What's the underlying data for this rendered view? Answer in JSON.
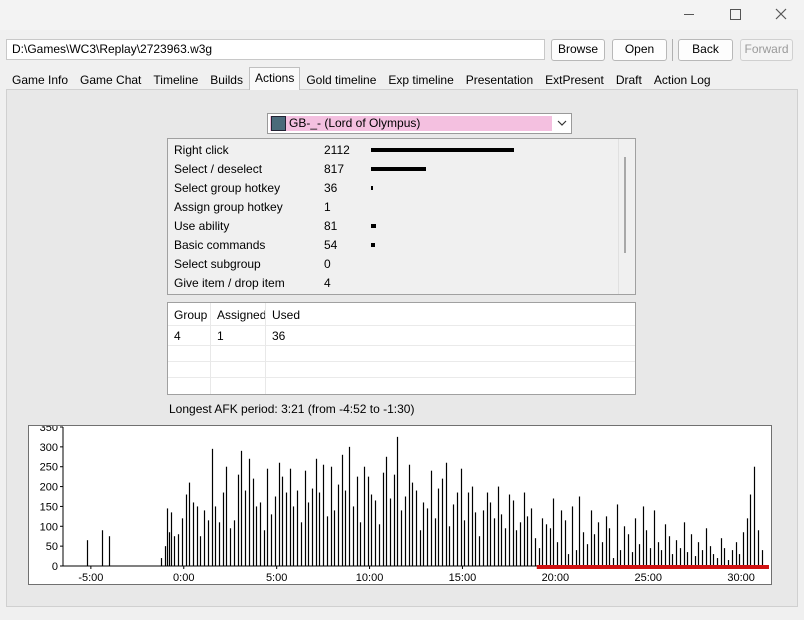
{
  "window": {
    "minimize_icon": "minimize-icon",
    "maximize_icon": "maximize-icon",
    "close_icon": "close-icon"
  },
  "toolbar": {
    "path": "D:\\Games\\WC3\\Replay\\2723963.w3g",
    "browse": "Browse",
    "open": "Open",
    "back": "Back",
    "forward": "Forward"
  },
  "tabs": [
    "Game Info",
    "Game Chat",
    "Timeline",
    "Builds",
    "Actions",
    "Gold timeline",
    "Exp timeline",
    "Presentation",
    "ExtPresent",
    "Draft",
    "Action Log"
  ],
  "active_tab": "Actions",
  "player": {
    "name": "GB-_- (Lord of Olympus)",
    "highlight_color": "#f4c0e0"
  },
  "actions": [
    {
      "name": "Right click",
      "count": 2112
    },
    {
      "name": "Select / deselect",
      "count": 817
    },
    {
      "name": "Select group hotkey",
      "count": 36
    },
    {
      "name": "Assign group hotkey",
      "count": 1
    },
    {
      "name": "Use ability",
      "count": 81
    },
    {
      "name": "Basic commands",
      "count": 54
    },
    {
      "name": "Select subgroup",
      "count": 0
    },
    {
      "name": "Give item / drop item",
      "count": 4
    }
  ],
  "hotkeys": {
    "headers": [
      "Group",
      "Assigned",
      "Used"
    ],
    "rows": [
      [
        "4",
        "1",
        "36"
      ]
    ]
  },
  "afk_text": "Longest AFK period: 3:21 (from -4:52 to -1:30)",
  "chart_data": {
    "type": "bar",
    "y_ticks": [
      0,
      50,
      100,
      150,
      200,
      250,
      300,
      350
    ],
    "ylim": [
      0,
      350
    ],
    "x_ticks": [
      "-5:00",
      "0:00",
      "5:00",
      "10:00",
      "15:00",
      "20:00",
      "25:00",
      "30:00"
    ],
    "x_tick_minutes": [
      -5,
      0,
      5,
      10,
      15,
      20,
      25,
      30
    ],
    "xlim_minutes": [
      -6.5,
      31.5
    ],
    "bar_color": "#000000",
    "afk_marker": {
      "from_minute": 19,
      "to_minute": 31.5,
      "color": "#d01010"
    },
    "x_minutes": [
      -5.2,
      -4.4,
      -4.0,
      -1.2,
      -1.0,
      -0.9,
      -0.8,
      -0.7,
      -0.5,
      -0.3,
      -0.1,
      0.1,
      0.3,
      0.5,
      0.7,
      0.9,
      1.1,
      1.3,
      1.5,
      1.7,
      1.9,
      2.1,
      2.3,
      2.5,
      2.7,
      2.9,
      3.1,
      3.3,
      3.5,
      3.7,
      3.9,
      4.1,
      4.3,
      4.5,
      4.7,
      4.9,
      5.1,
      5.3,
      5.5,
      5.7,
      5.9,
      6.1,
      6.3,
      6.5,
      6.7,
      6.9,
      7.1,
      7.3,
      7.5,
      7.7,
      7.9,
      8.1,
      8.3,
      8.5,
      8.7,
      8.9,
      9.1,
      9.3,
      9.5,
      9.7,
      9.9,
      10.1,
      10.3,
      10.5,
      10.7,
      10.9,
      11.1,
      11.3,
      11.5,
      11.7,
      11.9,
      12.1,
      12.3,
      12.5,
      12.7,
      12.9,
      13.1,
      13.3,
      13.5,
      13.7,
      13.9,
      14.1,
      14.3,
      14.5,
      14.7,
      14.9,
      15.1,
      15.3,
      15.5,
      15.7,
      15.9,
      16.1,
      16.3,
      16.5,
      16.7,
      16.9,
      17.1,
      17.3,
      17.5,
      17.7,
      17.9,
      18.1,
      18.3,
      18.5,
      18.7,
      18.9,
      19.1,
      19.3,
      19.5,
      19.7,
      19.9,
      20.1,
      20.3,
      20.5,
      20.7,
      20.9,
      21.1,
      21.3,
      21.5,
      21.7,
      21.9,
      22.1,
      22.3,
      22.5,
      22.7,
      22.9,
      23.1,
      23.3,
      23.5,
      23.7,
      23.9,
      24.1,
      24.3,
      24.5,
      24.7,
      24.9,
      25.1,
      25.3,
      25.5,
      25.7,
      25.9,
      26.1,
      26.3,
      26.5,
      26.7,
      26.9,
      27.1,
      27.3,
      27.5,
      27.7,
      27.9,
      28.1,
      28.3,
      28.5,
      28.7,
      28.9,
      29.1,
      29.3,
      29.5,
      29.7,
      29.9,
      30.1,
      30.3,
      30.5,
      30.7,
      30.9,
      31.1
    ],
    "values": [
      65,
      90,
      75,
      20,
      50,
      145,
      85,
      135,
      75,
      80,
      120,
      180,
      210,
      160,
      150,
      75,
      140,
      115,
      295,
      150,
      110,
      185,
      250,
      95,
      115,
      230,
      290,
      190,
      270,
      220,
      150,
      160,
      90,
      245,
      130,
      175,
      260,
      225,
      185,
      245,
      150,
      190,
      110,
      240,
      160,
      195,
      270,
      185,
      255,
      125,
      250,
      140,
      205,
      280,
      190,
      300,
      150,
      225,
      110,
      250,
      225,
      180,
      165,
      105,
      235,
      275,
      170,
      230,
      325,
      140,
      175,
      255,
      210,
      190,
      90,
      160,
      145,
      240,
      120,
      195,
      220,
      260,
      100,
      155,
      185,
      245,
      115,
      185,
      200,
      135,
      75,
      140,
      185,
      160,
      120,
      200,
      130,
      95,
      180,
      165,
      90,
      110,
      185,
      125,
      145,
      70,
      45,
      120,
      105,
      95,
      170,
      60,
      140,
      115,
      30,
      150,
      40,
      175,
      85,
      55,
      140,
      80,
      110,
      60,
      125,
      95,
      20,
      155,
      40,
      100,
      80,
      35,
      120,
      55,
      150,
      90,
      45,
      140,
      60,
      40,
      105,
      75,
      30,
      65,
      45,
      110,
      35,
      80,
      25,
      60,
      40,
      95,
      50,
      30,
      20,
      70,
      45,
      15,
      40,
      60,
      30,
      85,
      120,
      180,
      250,
      90,
      40
    ]
  }
}
